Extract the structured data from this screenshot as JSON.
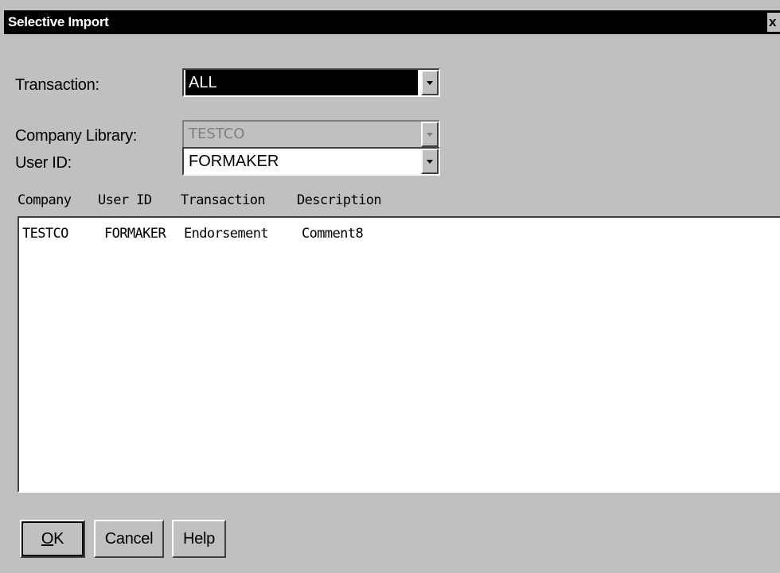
{
  "window": {
    "title": "Selective Import",
    "close_glyph": "x"
  },
  "form": {
    "transaction": {
      "label": "Transaction:",
      "value": "ALL"
    },
    "company_library": {
      "label": "Company Library:",
      "value": "TESTCO"
    },
    "user_id": {
      "label": "User ID:",
      "value": "FORMAKER"
    }
  },
  "list": {
    "columns": [
      "Company",
      "User ID",
      "Transaction",
      "Description"
    ],
    "rows": [
      {
        "company": "TESTCO",
        "user_id": "FORMAKER",
        "transaction": "Endorsement",
        "description": "Comment8"
      }
    ]
  },
  "buttons": {
    "ok_mnemonic": "O",
    "ok_rest": "K",
    "cancel": "Cancel",
    "help": "Help"
  },
  "colors": {
    "dialog_bg": "#c0c0c0",
    "titlebar_bg": "#000000",
    "field_bg": "#ffffff"
  }
}
